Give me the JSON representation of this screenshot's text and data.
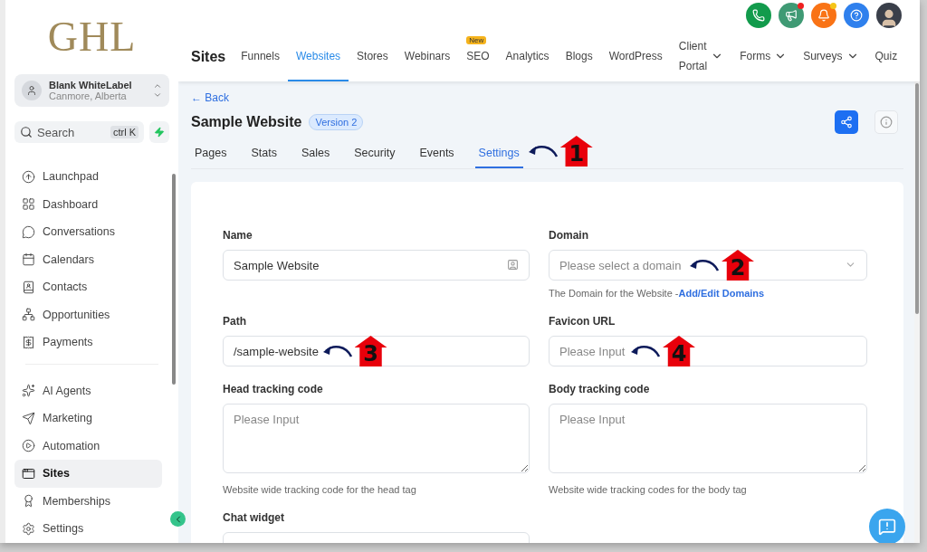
{
  "sidebar": {
    "logo": "GHL",
    "account": {
      "name": "Blank WhiteLabel",
      "location": "Canmore, Alberta"
    },
    "search": {
      "placeholder": "Search",
      "shortcut": "ctrl K"
    },
    "nav_groups": [
      [
        {
          "label": "Launchpad",
          "selected": false
        },
        {
          "label": "Dashboard",
          "selected": false
        },
        {
          "label": "Conversations",
          "selected": false
        },
        {
          "label": "Calendars",
          "selected": false
        },
        {
          "label": "Contacts",
          "selected": false
        },
        {
          "label": "Opportunities",
          "selected": false
        },
        {
          "label": "Payments",
          "selected": false
        }
      ],
      [
        {
          "label": "AI Agents",
          "selected": false
        },
        {
          "label": "Marketing",
          "selected": false
        },
        {
          "label": "Automation",
          "selected": false
        },
        {
          "label": "Sites",
          "selected": true
        },
        {
          "label": "Memberships",
          "selected": false
        },
        {
          "label": "Settings",
          "selected": false
        }
      ]
    ]
  },
  "header": {
    "title": "Sites",
    "tabs": [
      {
        "label": "Funnels",
        "selected": false,
        "has_menu": false
      },
      {
        "label": "Websites",
        "selected": true,
        "has_menu": false
      },
      {
        "label": "Stores",
        "selected": false,
        "has_menu": false
      },
      {
        "label": "Webinars",
        "selected": false,
        "has_menu": false
      },
      {
        "label": "SEO",
        "selected": false,
        "has_menu": false,
        "badge": "New"
      },
      {
        "label": "Analytics",
        "selected": false,
        "has_menu": false
      },
      {
        "label": "Blogs",
        "selected": false,
        "has_menu": false
      },
      {
        "label": "WordPress",
        "selected": false,
        "has_menu": false
      },
      {
        "label": "Client Portal",
        "selected": false,
        "has_menu": true
      },
      {
        "label": "Forms",
        "selected": false,
        "has_menu": true
      },
      {
        "label": "Surveys",
        "selected": false,
        "has_menu": true
      },
      {
        "label": "Quiz",
        "selected": false,
        "has_menu": false
      }
    ],
    "notifications": [
      {
        "kind": "phone",
        "unread": false
      },
      {
        "kind": "megaphone",
        "unread": true
      },
      {
        "kind": "bell",
        "unread": true
      },
      {
        "kind": "help",
        "unread": false
      }
    ]
  },
  "page": {
    "back": "← Back",
    "title": "Sample Website",
    "version": "Version 2",
    "tabs": [
      {
        "label": "Pages",
        "selected": false
      },
      {
        "label": "Stats",
        "selected": false
      },
      {
        "label": "Sales",
        "selected": false
      },
      {
        "label": "Security",
        "selected": false
      },
      {
        "label": "Events",
        "selected": false
      },
      {
        "label": "Settings",
        "selected": true,
        "callout": "1"
      }
    ],
    "fields": [
      {
        "label": "Name",
        "kind": "text",
        "value": "Sample Website"
      },
      {
        "label": "Domain",
        "kind": "select",
        "placeholder": "Please select a domain",
        "callout": "2",
        "help": "The Domain for the Website -",
        "help_link": "Add/Edit Domains"
      },
      {
        "label": "Path",
        "kind": "text",
        "value": "/sample-website",
        "callout": "3"
      },
      {
        "label": "Favicon URL",
        "kind": "text",
        "placeholder": "Please Input",
        "callout": "4"
      },
      {
        "label": "Head tracking code",
        "kind": "textarea",
        "placeholder": "Please Input",
        "help": "Website wide tracking code for the head tag"
      },
      {
        "label": "Body tracking code",
        "kind": "textarea",
        "placeholder": "Please Input",
        "help": "Website wide tracking codes for the body tag"
      },
      {
        "label": "Chat widget",
        "kind": "text"
      }
    ]
  }
}
